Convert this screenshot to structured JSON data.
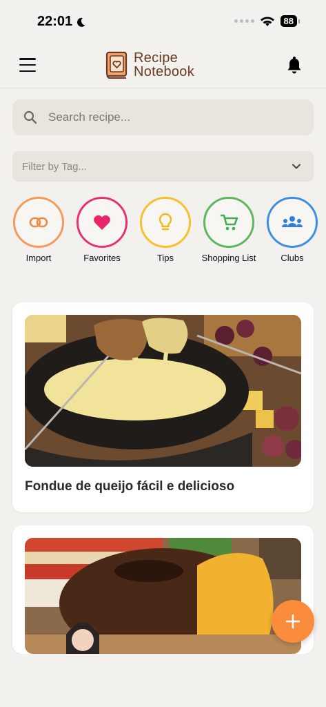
{
  "status_bar": {
    "time": "22:01",
    "battery": "88"
  },
  "header": {
    "brand_line1": "Recipe",
    "brand_line2": "Notebook"
  },
  "search": {
    "placeholder": "Search recipe..."
  },
  "filter": {
    "placeholder": "Filter by Tag..."
  },
  "quick_actions": [
    {
      "label": "Import",
      "icon": "link-icon",
      "color": "#f59a5c"
    },
    {
      "label": "Favorites",
      "icon": "heart-icon",
      "color": "#e6336e"
    },
    {
      "label": "Tips",
      "icon": "lightbulb-icon",
      "color": "#f6c02e"
    },
    {
      "label": "Shopping List",
      "icon": "cart-icon",
      "color": "#5cb85c"
    },
    {
      "label": "Clubs",
      "icon": "group-icon",
      "color": "#3d8fe0"
    }
  ],
  "recipes": [
    {
      "title": "Fondue de queijo fácil e delicioso"
    },
    {
      "title": ""
    }
  ],
  "colors": {
    "accent": "#fb8c3b",
    "brand": "#6a3a22",
    "background": "#f3f1ee"
  }
}
